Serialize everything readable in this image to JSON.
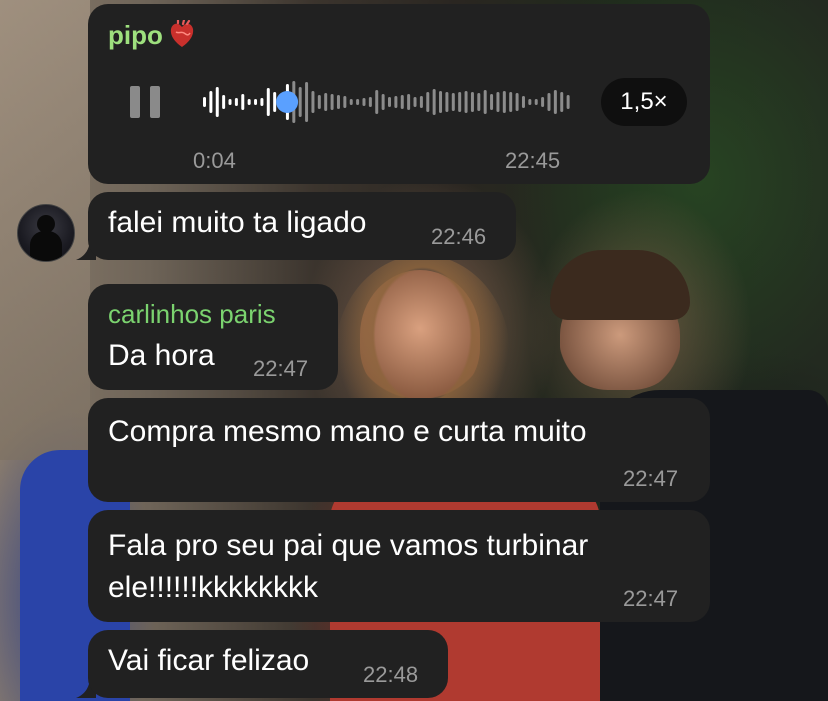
{
  "colors": {
    "bubble_bg": "#212121",
    "sender_pipo": "#9ee07e",
    "sender_carlinhos": "#7bd36f",
    "time_color": "#9a9a9a",
    "wave_played": "#ffffff",
    "wave_unplayed": "#8c8c8c",
    "scrubber": "#5aa0ff"
  },
  "voice_message": {
    "sender": "pipo",
    "sender_emoji_icon": "anatomical-heart-icon",
    "elapsed": "0:04",
    "time": "22:45",
    "speed": "1,5×",
    "progress_fraction": 0.23,
    "state_icon": "pause-icon"
  },
  "messages": [
    {
      "text": "falei muito ta ligado",
      "time": "22:46"
    },
    {
      "sender": "carlinhos paris",
      "text": "Da hora",
      "time": "22:47"
    },
    {
      "text": "Compra mesmo mano e curta muito",
      "time": "22:47"
    },
    {
      "text": "Fala pro seu pai que vamos turbinar\nele!!!!!!kkkkkkkk",
      "time": "22:47"
    },
    {
      "text": "Vai ficar felizao",
      "time": "22:48"
    }
  ],
  "avatar_icon": "contact-avatar-icon"
}
